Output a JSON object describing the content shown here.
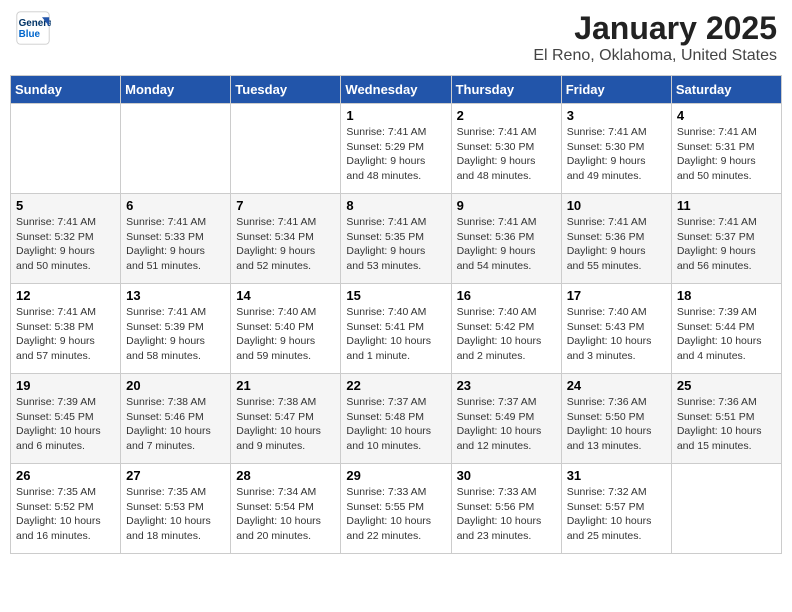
{
  "logo": {
    "line1": "General",
    "line2": "Blue"
  },
  "title": "January 2025",
  "location": "El Reno, Oklahoma, United States",
  "weekdays": [
    "Sunday",
    "Monday",
    "Tuesday",
    "Wednesday",
    "Thursday",
    "Friday",
    "Saturday"
  ],
  "weeks": [
    [
      {
        "day": "",
        "content": ""
      },
      {
        "day": "",
        "content": ""
      },
      {
        "day": "",
        "content": ""
      },
      {
        "day": "1",
        "content": "Sunrise: 7:41 AM\nSunset: 5:29 PM\nDaylight: 9 hours and 48 minutes."
      },
      {
        "day": "2",
        "content": "Sunrise: 7:41 AM\nSunset: 5:30 PM\nDaylight: 9 hours and 48 minutes."
      },
      {
        "day": "3",
        "content": "Sunrise: 7:41 AM\nSunset: 5:30 PM\nDaylight: 9 hours and 49 minutes."
      },
      {
        "day": "4",
        "content": "Sunrise: 7:41 AM\nSunset: 5:31 PM\nDaylight: 9 hours and 50 minutes."
      }
    ],
    [
      {
        "day": "5",
        "content": "Sunrise: 7:41 AM\nSunset: 5:32 PM\nDaylight: 9 hours and 50 minutes."
      },
      {
        "day": "6",
        "content": "Sunrise: 7:41 AM\nSunset: 5:33 PM\nDaylight: 9 hours and 51 minutes."
      },
      {
        "day": "7",
        "content": "Sunrise: 7:41 AM\nSunset: 5:34 PM\nDaylight: 9 hours and 52 minutes."
      },
      {
        "day": "8",
        "content": "Sunrise: 7:41 AM\nSunset: 5:35 PM\nDaylight: 9 hours and 53 minutes."
      },
      {
        "day": "9",
        "content": "Sunrise: 7:41 AM\nSunset: 5:36 PM\nDaylight: 9 hours and 54 minutes."
      },
      {
        "day": "10",
        "content": "Sunrise: 7:41 AM\nSunset: 5:36 PM\nDaylight: 9 hours and 55 minutes."
      },
      {
        "day": "11",
        "content": "Sunrise: 7:41 AM\nSunset: 5:37 PM\nDaylight: 9 hours and 56 minutes."
      }
    ],
    [
      {
        "day": "12",
        "content": "Sunrise: 7:41 AM\nSunset: 5:38 PM\nDaylight: 9 hours and 57 minutes."
      },
      {
        "day": "13",
        "content": "Sunrise: 7:41 AM\nSunset: 5:39 PM\nDaylight: 9 hours and 58 minutes."
      },
      {
        "day": "14",
        "content": "Sunrise: 7:40 AM\nSunset: 5:40 PM\nDaylight: 9 hours and 59 minutes."
      },
      {
        "day": "15",
        "content": "Sunrise: 7:40 AM\nSunset: 5:41 PM\nDaylight: 10 hours and 1 minute."
      },
      {
        "day": "16",
        "content": "Sunrise: 7:40 AM\nSunset: 5:42 PM\nDaylight: 10 hours and 2 minutes."
      },
      {
        "day": "17",
        "content": "Sunrise: 7:40 AM\nSunset: 5:43 PM\nDaylight: 10 hours and 3 minutes."
      },
      {
        "day": "18",
        "content": "Sunrise: 7:39 AM\nSunset: 5:44 PM\nDaylight: 10 hours and 4 minutes."
      }
    ],
    [
      {
        "day": "19",
        "content": "Sunrise: 7:39 AM\nSunset: 5:45 PM\nDaylight: 10 hours and 6 minutes."
      },
      {
        "day": "20",
        "content": "Sunrise: 7:38 AM\nSunset: 5:46 PM\nDaylight: 10 hours and 7 minutes."
      },
      {
        "day": "21",
        "content": "Sunrise: 7:38 AM\nSunset: 5:47 PM\nDaylight: 10 hours and 9 minutes."
      },
      {
        "day": "22",
        "content": "Sunrise: 7:37 AM\nSunset: 5:48 PM\nDaylight: 10 hours and 10 minutes."
      },
      {
        "day": "23",
        "content": "Sunrise: 7:37 AM\nSunset: 5:49 PM\nDaylight: 10 hours and 12 minutes."
      },
      {
        "day": "24",
        "content": "Sunrise: 7:36 AM\nSunset: 5:50 PM\nDaylight: 10 hours and 13 minutes."
      },
      {
        "day": "25",
        "content": "Sunrise: 7:36 AM\nSunset: 5:51 PM\nDaylight: 10 hours and 15 minutes."
      }
    ],
    [
      {
        "day": "26",
        "content": "Sunrise: 7:35 AM\nSunset: 5:52 PM\nDaylight: 10 hours and 16 minutes."
      },
      {
        "day": "27",
        "content": "Sunrise: 7:35 AM\nSunset: 5:53 PM\nDaylight: 10 hours and 18 minutes."
      },
      {
        "day": "28",
        "content": "Sunrise: 7:34 AM\nSunset: 5:54 PM\nDaylight: 10 hours and 20 minutes."
      },
      {
        "day": "29",
        "content": "Sunrise: 7:33 AM\nSunset: 5:55 PM\nDaylight: 10 hours and 22 minutes."
      },
      {
        "day": "30",
        "content": "Sunrise: 7:33 AM\nSunset: 5:56 PM\nDaylight: 10 hours and 23 minutes."
      },
      {
        "day": "31",
        "content": "Sunrise: 7:32 AM\nSunset: 5:57 PM\nDaylight: 10 hours and 25 minutes."
      },
      {
        "day": "",
        "content": ""
      }
    ]
  ]
}
